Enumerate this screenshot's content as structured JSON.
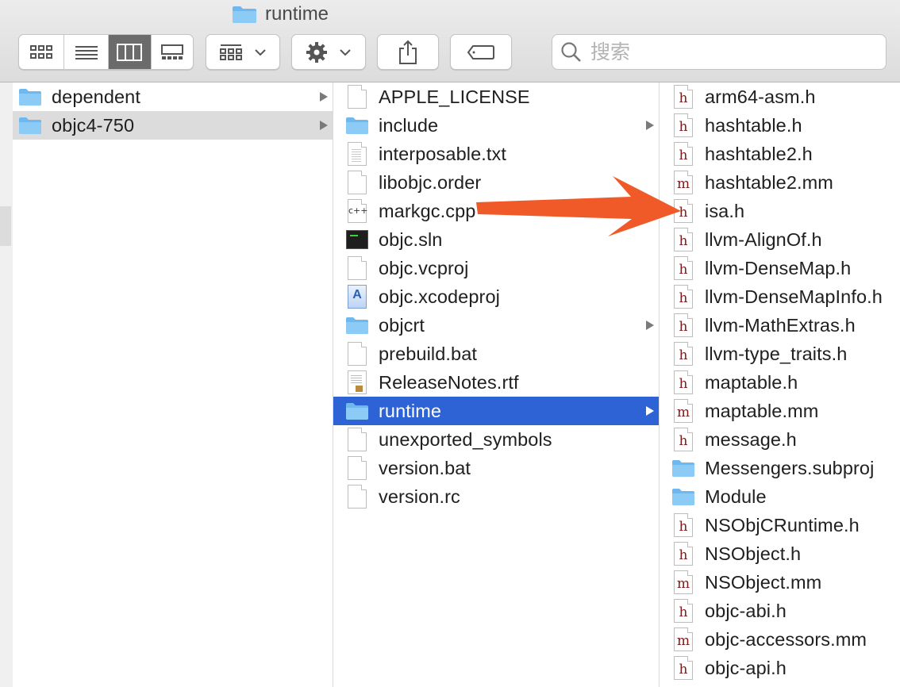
{
  "window": {
    "title": "runtime"
  },
  "toolbar": {
    "view_modes": [
      "icon-view",
      "list-view",
      "column-view",
      "gallery-view"
    ],
    "active_view": "column-view",
    "search": {
      "placeholder": "搜索",
      "value": ""
    }
  },
  "columns": {
    "col1": [
      {
        "label": "dependent",
        "icon": "folder-icon",
        "has_children": true
      },
      {
        "label": "objc4-750",
        "icon": "folder-icon",
        "has_children": true,
        "selected": true
      }
    ],
    "col2": [
      {
        "label": "APPLE_LICENSE",
        "icon": "document-icon"
      },
      {
        "label": "include",
        "icon": "folder-icon",
        "has_children": true
      },
      {
        "label": "interposable.txt",
        "icon": "text-file-icon"
      },
      {
        "label": "libobjc.order",
        "icon": "document-icon"
      },
      {
        "label": "markgc.cpp",
        "icon": "cpp-file-icon"
      },
      {
        "label": "objc.sln",
        "icon": "terminal-file-icon"
      },
      {
        "label": "objc.vcproj",
        "icon": "document-icon"
      },
      {
        "label": "objc.xcodeproj",
        "icon": "xcodeproj-icon"
      },
      {
        "label": "objcrt",
        "icon": "folder-icon",
        "has_children": true
      },
      {
        "label": "prebuild.bat",
        "icon": "document-icon"
      },
      {
        "label": "ReleaseNotes.rtf",
        "icon": "rtf-file-icon"
      },
      {
        "label": "runtime",
        "icon": "folder-icon",
        "has_children": true,
        "selected": true
      },
      {
        "label": "unexported_symbols",
        "icon": "document-icon"
      },
      {
        "label": "version.bat",
        "icon": "document-icon"
      },
      {
        "label": "version.rc",
        "icon": "document-icon"
      }
    ],
    "col3": [
      {
        "label": "arm64-asm.h",
        "icon": "h-file-icon"
      },
      {
        "label": "hashtable.h",
        "icon": "h-file-icon"
      },
      {
        "label": "hashtable2.h",
        "icon": "h-file-icon"
      },
      {
        "label": "hashtable2.mm",
        "icon": "mm-file-icon"
      },
      {
        "label": "isa.h",
        "icon": "h-file-icon"
      },
      {
        "label": "llvm-AlignOf.h",
        "icon": "h-file-icon"
      },
      {
        "label": "llvm-DenseMap.h",
        "icon": "h-file-icon"
      },
      {
        "label": "llvm-DenseMapInfo.h",
        "icon": "h-file-icon"
      },
      {
        "label": "llvm-MathExtras.h",
        "icon": "h-file-icon"
      },
      {
        "label": "llvm-type_traits.h",
        "icon": "h-file-icon"
      },
      {
        "label": "maptable.h",
        "icon": "h-file-icon"
      },
      {
        "label": "maptable.mm",
        "icon": "mm-file-icon"
      },
      {
        "label": "message.h",
        "icon": "h-file-icon"
      },
      {
        "label": "Messengers.subproj",
        "icon": "folder-icon"
      },
      {
        "label": "Module",
        "icon": "folder-icon"
      },
      {
        "label": "NSObjCRuntime.h",
        "icon": "h-file-icon"
      },
      {
        "label": "NSObject.h",
        "icon": "h-file-icon"
      },
      {
        "label": "NSObject.mm",
        "icon": "mm-file-icon"
      },
      {
        "label": "objc-abi.h",
        "icon": "h-file-icon"
      },
      {
        "label": "objc-accessors.mm",
        "icon": "mm-file-icon"
      },
      {
        "label": "objc-api.h",
        "icon": "h-file-icon"
      }
    ]
  },
  "annotation": {
    "icon": "red-arrow-icon",
    "color": "#f05a28",
    "points_to": "isa.h"
  },
  "colors": {
    "selection_blue": "#2d63d4",
    "selection_gray": "#dcdcdc",
    "folder": "#6fb8ef",
    "arrow": "#f05a28"
  }
}
